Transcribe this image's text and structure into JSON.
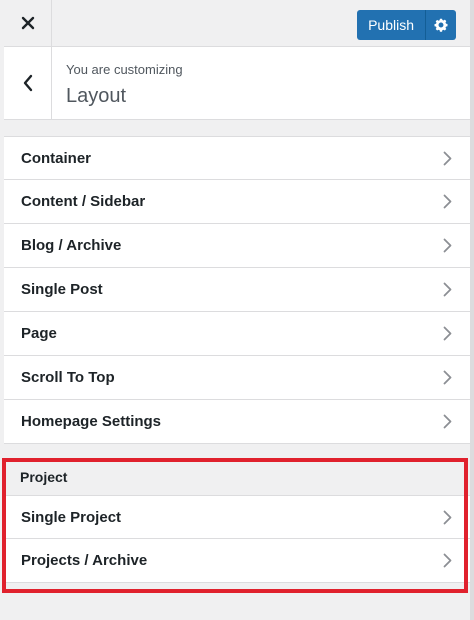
{
  "toolbar": {
    "close_icon": "close-icon",
    "publish_label": "Publish",
    "settings_icon": "gear-icon",
    "accent_color": "#2271b1"
  },
  "panel": {
    "back_icon": "chevron-left-icon",
    "customizing_label": "You are customizing",
    "title": "Layout"
  },
  "sections": [
    {
      "label": "Container"
    },
    {
      "label": "Content / Sidebar"
    },
    {
      "label": "Blog / Archive"
    },
    {
      "label": "Single Post"
    },
    {
      "label": "Page"
    },
    {
      "label": "Scroll To Top"
    },
    {
      "label": "Homepage Settings"
    }
  ],
  "project_group": {
    "heading": "Project",
    "highlight_color": "#e0212d",
    "items": [
      {
        "label": "Single Project"
      },
      {
        "label": "Projects / Archive"
      }
    ]
  }
}
